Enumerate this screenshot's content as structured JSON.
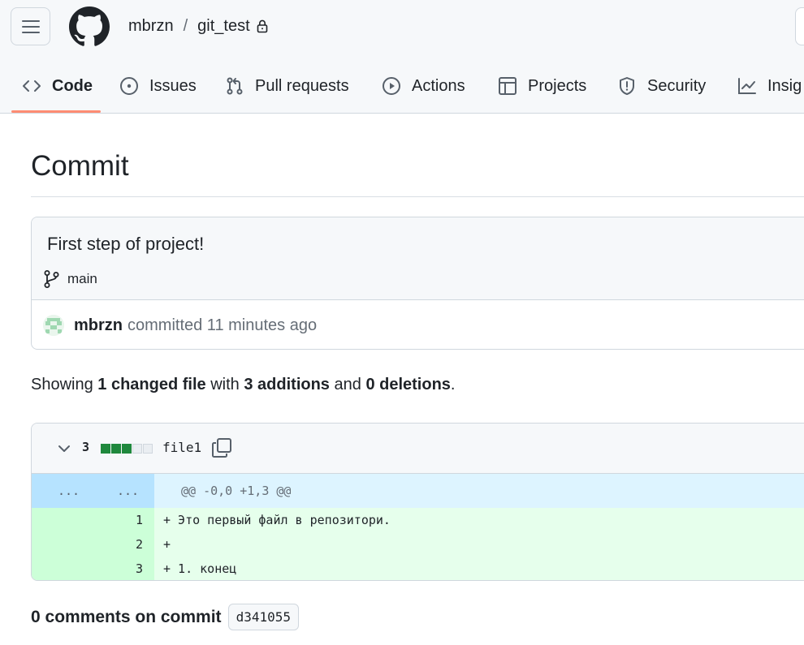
{
  "header": {
    "owner": "mbrzn",
    "separator": "/",
    "repo": "git_test"
  },
  "tabs": [
    {
      "label": "Code",
      "icon": "code-icon",
      "active": true
    },
    {
      "label": "Issues",
      "icon": "issue-opened-icon",
      "active": false
    },
    {
      "label": "Pull requests",
      "icon": "git-pull-request-icon",
      "active": false
    },
    {
      "label": "Actions",
      "icon": "play-icon",
      "active": false
    },
    {
      "label": "Projects",
      "icon": "table-icon",
      "active": false
    },
    {
      "label": "Security",
      "icon": "shield-icon",
      "active": false
    },
    {
      "label": "Insig",
      "icon": "graph-icon",
      "active": false
    }
  ],
  "page": {
    "title": "Commit"
  },
  "commit": {
    "message": "First step of project!",
    "branch": "main",
    "author": "mbrzn",
    "committed_text": "committed 11 minutes ago"
  },
  "summary": {
    "prefix": "Showing",
    "changed": "1 changed file",
    "with": "with",
    "additions": "3 additions",
    "and": "and",
    "deletions": "0 deletions",
    "end": "."
  },
  "diff": {
    "count": "3",
    "file_name": "file1",
    "hunk_old": "...",
    "hunk_new": "...",
    "hunk_header": "@@ -0,0 +1,3 @@",
    "lines": [
      {
        "new": "1",
        "text": "+ Это первый файл в репозитори."
      },
      {
        "new": "2",
        "text": "+"
      },
      {
        "new": "3",
        "text": "+ 1. конец"
      }
    ]
  },
  "comments": {
    "label": "0 comments on commit",
    "sha": "d341055"
  },
  "colors": {
    "accent_tab": "#fd8c73",
    "add_green": "#1f883d",
    "hunk_bg": "#ddf4ff",
    "add_bg": "#e6ffec"
  }
}
